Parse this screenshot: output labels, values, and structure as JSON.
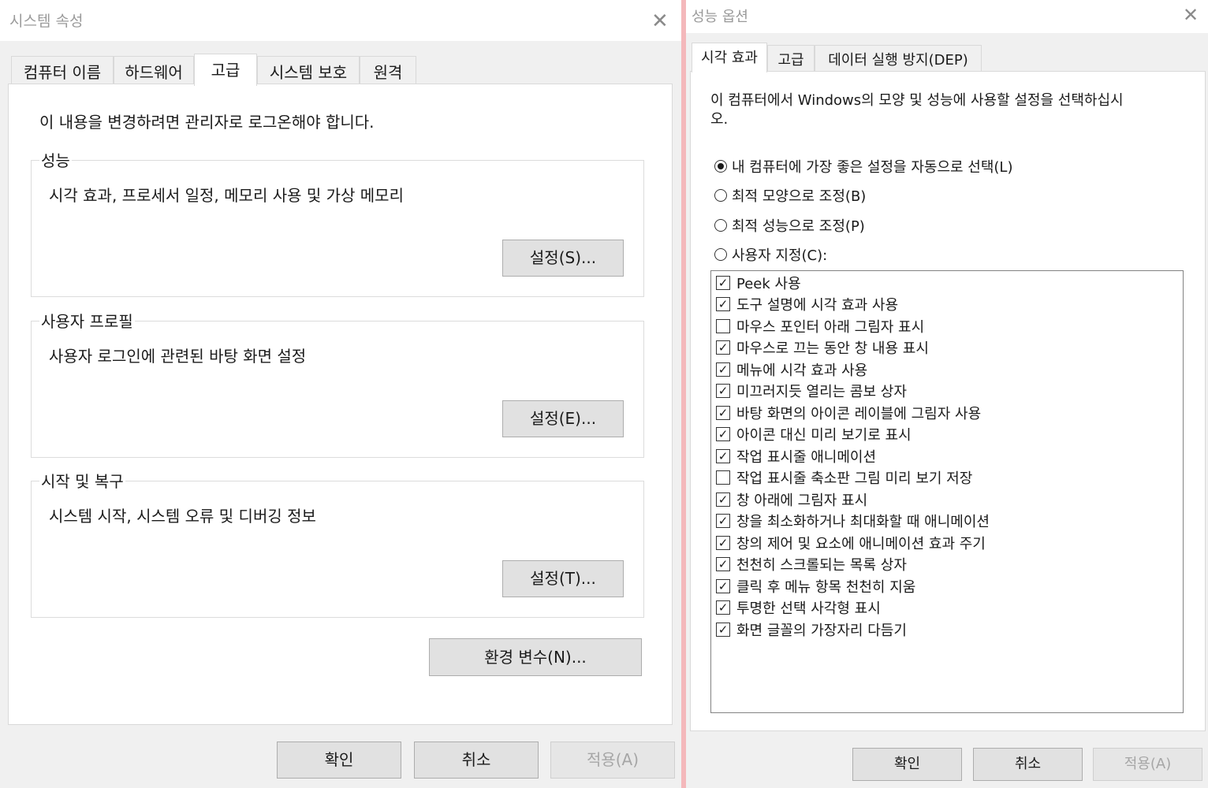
{
  "win1": {
    "title": "시스템 속성",
    "close_glyph": "✕",
    "tabs": [
      "컴퓨터 이름",
      "하드웨어",
      "고급",
      "시스템 보호",
      "원격"
    ],
    "notice": "이 내용을 변경하려면 관리자로 로그온해야 합니다.",
    "groups": [
      {
        "label": "성능",
        "desc": "시각 효과, 프로세서 일정, 메모리 사용 및 가상 메모리",
        "button": "설정(S)..."
      },
      {
        "label": "사용자 프로필",
        "desc": "사용자 로그인에 관련된 바탕 화면 설정",
        "button": "설정(E)..."
      },
      {
        "label": "시작 및 복구",
        "desc": "시스템 시작, 시스템 오류 및 디버깅 정보",
        "button": "설정(T)..."
      }
    ],
    "env_button": "환경 변수(N)...",
    "ok": "확인",
    "cancel": "취소",
    "apply": "적용(A)"
  },
  "win2": {
    "title": "성능 옵션",
    "close_glyph": "✕",
    "tabs": [
      "시각 효과",
      "고급",
      "데이터 실행 방지(DEP)"
    ],
    "intro_line1": "이 컴퓨터에서 Windows의 모양 및 성능에 사용할 설정을 선택하십시",
    "intro_line2": "오.",
    "radios": [
      {
        "label": "내 컴퓨터에 가장 좋은 설정을 자동으로 선택(L)",
        "selected": true
      },
      {
        "label": "최적 모양으로 조정(B)",
        "selected": false
      },
      {
        "label": "최적 성능으로 조정(P)",
        "selected": false
      },
      {
        "label": "사용자 지정(C):",
        "selected": false
      }
    ],
    "checks": [
      {
        "label": "Peek 사용",
        "checked": true
      },
      {
        "label": "도구 설명에 시각 효과 사용",
        "checked": true
      },
      {
        "label": "마우스 포인터 아래 그림자 표시",
        "checked": false
      },
      {
        "label": "마우스로 끄는 동안 창 내용 표시",
        "checked": true
      },
      {
        "label": "메뉴에 시각 효과 사용",
        "checked": true
      },
      {
        "label": "미끄러지듯 열리는 콤보 상자",
        "checked": true
      },
      {
        "label": "바탕 화면의 아이콘 레이블에 그림자 사용",
        "checked": true
      },
      {
        "label": "아이콘 대신 미리 보기로 표시",
        "checked": true
      },
      {
        "label": "작업 표시줄 애니메이션",
        "checked": true
      },
      {
        "label": "작업 표시줄 축소판 그림 미리 보기 저장",
        "checked": false
      },
      {
        "label": "창 아래에 그림자 표시",
        "checked": true
      },
      {
        "label": "창을 최소화하거나 최대화할 때 애니메이션",
        "checked": true
      },
      {
        "label": "창의 제어 및 요소에 애니메이션 효과 주기",
        "checked": true
      },
      {
        "label": "천천히 스크롤되는 목록 상자",
        "checked": true
      },
      {
        "label": "클릭 후 메뉴 항목 천천히 지움",
        "checked": true
      },
      {
        "label": "투명한 선택 사각형 표시",
        "checked": true
      },
      {
        "label": "화면 글꼴의 가장자리 다듬기",
        "checked": true
      }
    ],
    "ok": "확인",
    "cancel": "취소",
    "apply": "적용(A)"
  }
}
